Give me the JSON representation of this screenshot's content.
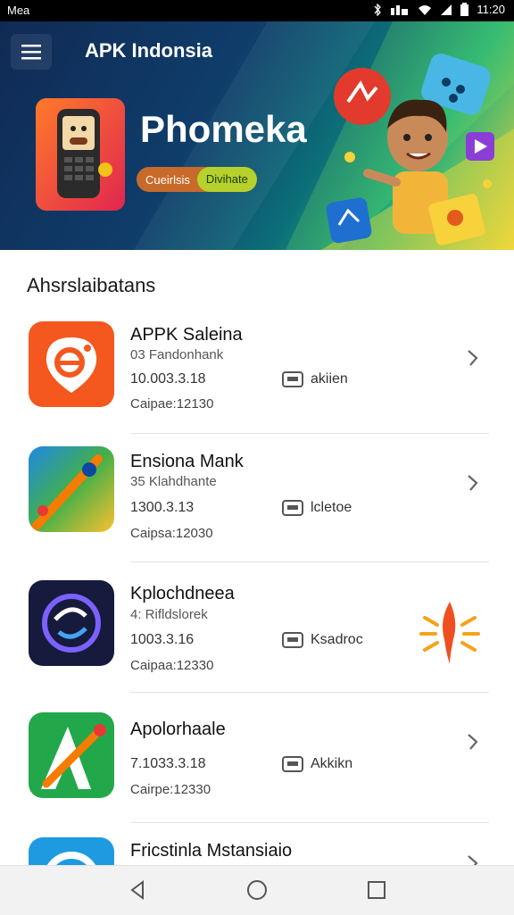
{
  "status_bar": {
    "left_text": "Mea",
    "time": "11:20"
  },
  "header": {
    "title": "APK Indonsia"
  },
  "banner": {
    "title": "Phomeka",
    "pill_left": "Cueirlsis",
    "pill_right": "Divihate"
  },
  "section": {
    "title": "Ahsrslaibatans"
  },
  "apps": [
    {
      "name": "APPK Saleina",
      "subtitle": "03 Fandonhank",
      "version": "10.003.3.18",
      "download": "akiien",
      "size": "Caipae:12130"
    },
    {
      "name": "Ensiona Mank",
      "subtitle": "35 Klahdhante",
      "version": "1300.3.13",
      "download": "lcletoe",
      "size": "Caipsa:12030"
    },
    {
      "name": "Kplochdneea",
      "subtitle": "4: Rifldslorek",
      "version": "1003.3.16",
      "download": "Ksadroc",
      "size": "Caipaa:12330"
    },
    {
      "name": "Apolorhaale",
      "subtitle": "",
      "version": "7.1033.3.18",
      "download": "Akkikn",
      "size": "Cairpe:12330"
    },
    {
      "name": "Fricstinla Mstansiaio",
      "subtitle": "",
      "version": "",
      "download": "",
      "size": ""
    }
  ],
  "colors": {
    "accent_orange": "#f4581e",
    "banner_dark": "#102a55",
    "lime": "#b6d12b"
  }
}
